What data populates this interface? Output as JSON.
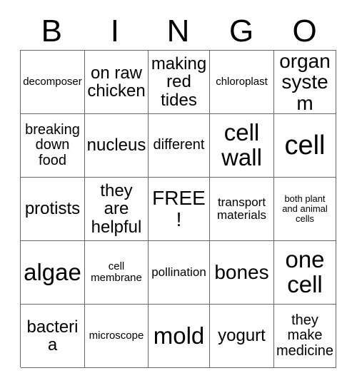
{
  "card": {
    "title": "BINGO",
    "header_letters": [
      "B",
      "I",
      "N",
      "G",
      "O"
    ],
    "rows": [
      [
        {
          "text": "decomposer",
          "size": "s-xs"
        },
        {
          "text": "on raw chicken",
          "size": "s-lg"
        },
        {
          "text": "making red tides",
          "size": "s-lg"
        },
        {
          "text": "chloroplast",
          "size": "s-xs"
        },
        {
          "text": "organ system",
          "size": "s-xl"
        }
      ],
      [
        {
          "text": "breaking down food",
          "size": "s-md"
        },
        {
          "text": "nucleus",
          "size": "s-lg"
        },
        {
          "text": "different",
          "size": "s-md"
        },
        {
          "text": "cell wall",
          "size": "s-xxl"
        },
        {
          "text": "cell",
          "size": "s-huge"
        }
      ],
      [
        {
          "text": "protists",
          "size": "s-lg"
        },
        {
          "text": "they are helpful",
          "size": "s-lg"
        },
        {
          "text": "FREE!",
          "size": "s-xl"
        },
        {
          "text": "transport materials",
          "size": "s-sm"
        },
        {
          "text": "both plant and animal cells",
          "size": "s-xxs"
        }
      ],
      [
        {
          "text": "algae",
          "size": "s-xxl"
        },
        {
          "text": "cell membrane",
          "size": "s-xs"
        },
        {
          "text": "pollination",
          "size": "s-sm"
        },
        {
          "text": "bones",
          "size": "s-xl"
        },
        {
          "text": "one cell",
          "size": "s-xxl"
        }
      ],
      [
        {
          "text": "bacteria",
          "size": "s-lg"
        },
        {
          "text": "microscope",
          "size": "s-xs"
        },
        {
          "text": "mold",
          "size": "s-xxl"
        },
        {
          "text": "yogurt",
          "size": "s-lg"
        },
        {
          "text": "they make medicine",
          "size": "s-md"
        }
      ]
    ],
    "free_space": "FREE!",
    "colors": {
      "background": "#ffffff",
      "text": "#000000",
      "grid_line": "#666666"
    }
  }
}
